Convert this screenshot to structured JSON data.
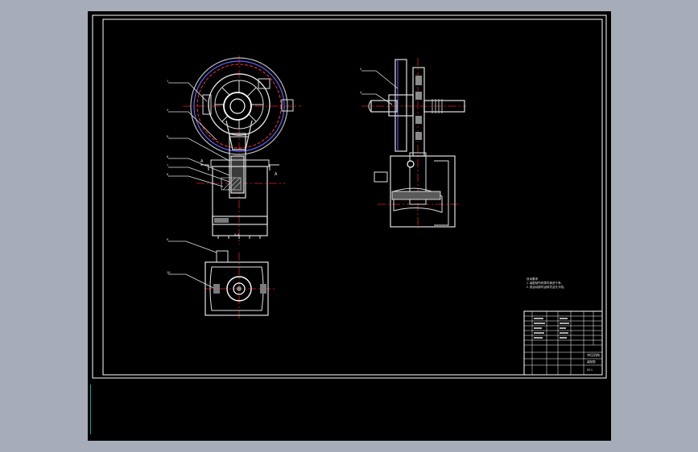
{
  "app": {
    "background": "#a6adb8",
    "canvas_background": "#000000"
  },
  "colors": {
    "frame": "#ffffff",
    "centerline": "#e02020",
    "hidden": "#6060ff",
    "cad_gray": "#8a8a8a"
  },
  "views": {
    "front": {
      "leaders": [
        "1",
        "3",
        "5",
        "6",
        "7",
        "8"
      ],
      "section_labels": [
        "A",
        "A",
        "A-A"
      ]
    },
    "side": {
      "leaders": [
        "2",
        "4"
      ]
    },
    "top": {
      "leaders": [
        "9",
        "10"
      ]
    }
  },
  "notes": {
    "heading": "技术要求",
    "lines": [
      "1. 装配前所有零件清洗干净。",
      "2. 各运动部件运转灵活无卡阻。"
    ]
  },
  "title_block": {
    "drawing_title": "冲压机构",
    "sheet_label": "装配图",
    "sheet_no": "00-1"
  },
  "command_line": {
    "text": ""
  }
}
